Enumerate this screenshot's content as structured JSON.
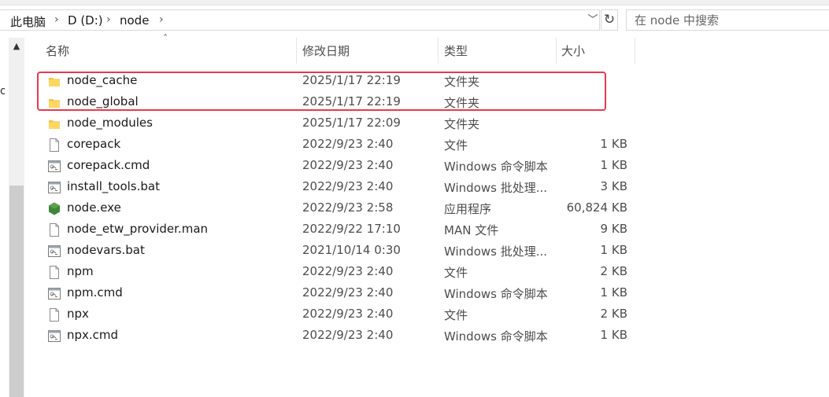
{
  "address": {
    "crumbs": [
      "此电脑",
      "D (D:)",
      "node"
    ],
    "separator": "›"
  },
  "search": {
    "placeholder": "在 node 中搜索"
  },
  "left_pane": {
    "partial_label": "or"
  },
  "columns": {
    "name": "名称",
    "date": "修改日期",
    "type": "类型",
    "size": "大小"
  },
  "files": [
    {
      "name": "node_cache",
      "date": "2025/1/17 22:19",
      "type": "文件夹",
      "size": "",
      "icon": "folder-icon"
    },
    {
      "name": "node_global",
      "date": "2025/1/17 22:19",
      "type": "文件夹",
      "size": "",
      "icon": "folder-icon"
    },
    {
      "name": "node_modules",
      "date": "2025/1/17 22:09",
      "type": "文件夹",
      "size": "",
      "icon": "folder-icon"
    },
    {
      "name": "corepack",
      "date": "2022/9/23 2:40",
      "type": "文件",
      "size": "1 KB",
      "icon": "file-icon"
    },
    {
      "name": "corepack.cmd",
      "date": "2022/9/23 2:40",
      "type": "Windows 命令脚本",
      "size": "1 KB",
      "icon": "script-icon"
    },
    {
      "name": "install_tools.bat",
      "date": "2022/9/23 2:40",
      "type": "Windows 批处理...",
      "size": "3 KB",
      "icon": "script-icon"
    },
    {
      "name": "node.exe",
      "date": "2022/9/23 2:58",
      "type": "应用程序",
      "size": "60,824 KB",
      "icon": "nodejs-icon"
    },
    {
      "name": "node_etw_provider.man",
      "date": "2022/9/22 17:10",
      "type": "MAN 文件",
      "size": "9 KB",
      "icon": "file-icon"
    },
    {
      "name": "nodevars.bat",
      "date": "2021/10/14 0:30",
      "type": "Windows 批处理...",
      "size": "1 KB",
      "icon": "script-icon"
    },
    {
      "name": "npm",
      "date": "2022/9/23 2:40",
      "type": "文件",
      "size": "2 KB",
      "icon": "file-icon"
    },
    {
      "name": "npm.cmd",
      "date": "2022/9/23 2:40",
      "type": "Windows 命令脚本",
      "size": "1 KB",
      "icon": "script-icon"
    },
    {
      "name": "npx",
      "date": "2022/9/23 2:40",
      "type": "文件",
      "size": "2 KB",
      "icon": "file-icon"
    },
    {
      "name": "npx.cmd",
      "date": "2022/9/23 2:40",
      "type": "Windows 命令脚本",
      "size": "1 KB",
      "icon": "script-icon"
    }
  ],
  "colors": {
    "highlight": "#e8394f",
    "folder": "#f6c244",
    "nodejs": "#3c873a"
  }
}
